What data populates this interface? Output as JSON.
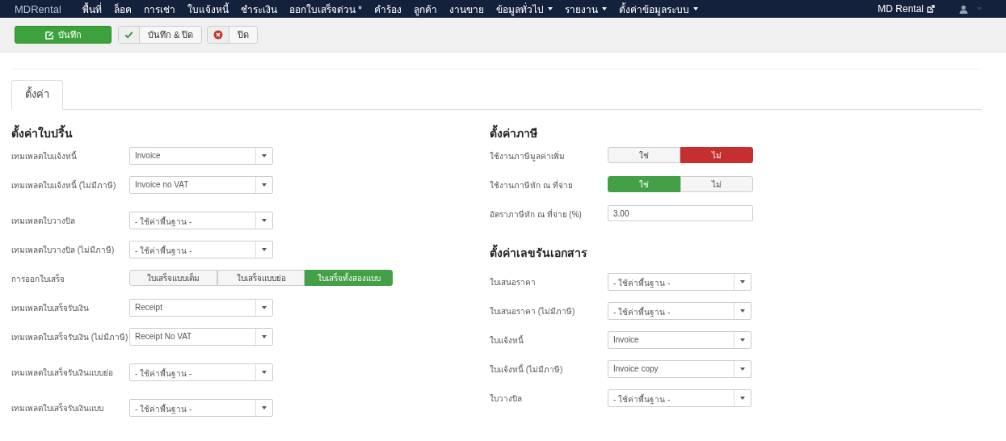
{
  "navbar": {
    "brand": "MDRental",
    "items": [
      {
        "label": "พื้นที่",
        "dropdown": false
      },
      {
        "label": "ล็อค",
        "dropdown": false
      },
      {
        "label": "การเช่า",
        "dropdown": false
      },
      {
        "label": "ใบแจ้งหนี้",
        "dropdown": false
      },
      {
        "label": "ชำระเงิน",
        "dropdown": false
      },
      {
        "label": "ออกใบเสร็จด่วน *",
        "dropdown": false
      },
      {
        "label": "คำร้อง",
        "dropdown": false
      },
      {
        "label": "ลูกค้า",
        "dropdown": false
      },
      {
        "label": "งานขาย",
        "dropdown": false
      },
      {
        "label": "ข้อมูลทั่วไป",
        "dropdown": true
      },
      {
        "label": "รายงาน",
        "dropdown": true
      },
      {
        "label": "ตั้งค่าข้อมูลระบบ",
        "dropdown": true
      }
    ],
    "site_link": "MD Rental"
  },
  "toolbar": [
    {
      "label": "บันทึก",
      "kind": "save"
    },
    {
      "label": "บันทึก & ปิด",
      "kind": "save-close"
    },
    {
      "label": "ปิด",
      "kind": "close"
    }
  ],
  "tabs": [
    {
      "label": "ตั้งค่า",
      "selected": true
    }
  ],
  "print_settings": {
    "title": "ตั้งค่าใบปริ้น",
    "rows": [
      {
        "kind": "select",
        "label": "เทมเพลตใบแจ้งหนี้",
        "value": "Invoice"
      },
      {
        "kind": "select",
        "label": "เทมเพลตใบแจ้งหนี้ (ไม่มีภาษี)",
        "value": "Invoice no VAT"
      },
      {
        "kind": "select",
        "label": "เทมเพลตใบวางบิล",
        "value": "- ใช้ค่าพื้นฐาน -"
      },
      {
        "kind": "select",
        "label": "เทมเพลตใบวางบิล (ไม่มีภาษี)",
        "value": "- ใช้ค่าพื้นฐาน -"
      },
      {
        "kind": "toggle",
        "label": "การออกใบเสร็จ",
        "options": [
          {
            "label": "ใบเสร็จแบบเต็ม",
            "selected": false,
            "kind": "positive"
          },
          {
            "label": "ใบเสร็จแบบย่อ",
            "selected": false,
            "kind": "positive"
          },
          {
            "label": "ใบเสร็จทั้งสองแบบ",
            "selected": true,
            "kind": "positive"
          }
        ]
      },
      {
        "kind": "select",
        "label": "เทมเพลตใบเสร็จรับเงิน",
        "value": "Receipt"
      },
      {
        "kind": "select",
        "label": "เทมเพลตใบเสร็จรับเงิน (ไม่มีภาษี)",
        "value": "Receipt No VAT"
      },
      {
        "kind": "select",
        "label": "เทมเพลตใบเสร็จรับเงินแบบย่อ",
        "value": "- ใช้ค่าพื้นฐาน -"
      },
      {
        "kind": "select",
        "label": "เทมเพลตใบเสร็จรับเงินแบบ",
        "value": "- ใช้ค่าพื้นฐาน -"
      }
    ]
  },
  "tax_settings": {
    "title": "ตั้งค่าภาษี",
    "rows": [
      {
        "kind": "toggle",
        "label": "ใช้งานภาษีมูลค่าเพิ่ม",
        "options": [
          {
            "label": "ใช่",
            "selected": false,
            "kind": "positive"
          },
          {
            "label": "ไม่",
            "selected": true,
            "kind": "negative"
          }
        ]
      },
      {
        "kind": "toggle",
        "label": "ใช้งานภาษีหัก ณ ที่จ่าย",
        "options": [
          {
            "label": "ใช่",
            "selected": true,
            "kind": "positive"
          },
          {
            "label": "ไม่",
            "selected": false,
            "kind": "negative"
          }
        ]
      },
      {
        "kind": "text",
        "label": "อัตราภาษีหัก ณ ที่จ่าย (%)",
        "value": "3.00"
      }
    ]
  },
  "numbering_settings": {
    "title": "ตั้งค่าเลขรันเอกสาร",
    "rows": [
      {
        "kind": "select",
        "label": "ใบเสนอราคา",
        "value": "- ใช้ค่าพื้นฐาน -"
      },
      {
        "kind": "select",
        "label": "ใบเสนอราคา (ไม่มีภาษี)",
        "value": "- ใช้ค่าพื้นฐาน -"
      },
      {
        "kind": "select",
        "label": "ใบแจ้งหนี้",
        "value": "Invoice"
      },
      {
        "kind": "select",
        "label": "ใบแจ้งหนี้ (ไม่มีภาษี)",
        "value": "Invoice copy"
      },
      {
        "kind": "select",
        "label": "ใบวางบิล",
        "value": "- ใช้ค่าพื้นฐาน -"
      }
    ]
  }
}
